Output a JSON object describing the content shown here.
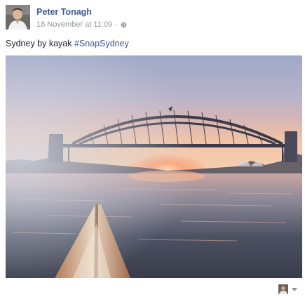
{
  "post": {
    "author_name": "Peter Tonagh",
    "timestamp": "18 November at 11:09",
    "separator": "·",
    "privacy_icon": "globe-icon",
    "text": "Sydney by kayak ",
    "hashtag": "#SnapSydney",
    "photo_subject": "sunrise-over-harbour-bridge-from-kayak",
    "footer": {
      "actor_icon": "actor-avatar-icon",
      "menu_icon": "chevron-down-icon"
    }
  },
  "colors": {
    "link": "#3b5998",
    "meta": "#90949c",
    "text": "#1d2129"
  }
}
